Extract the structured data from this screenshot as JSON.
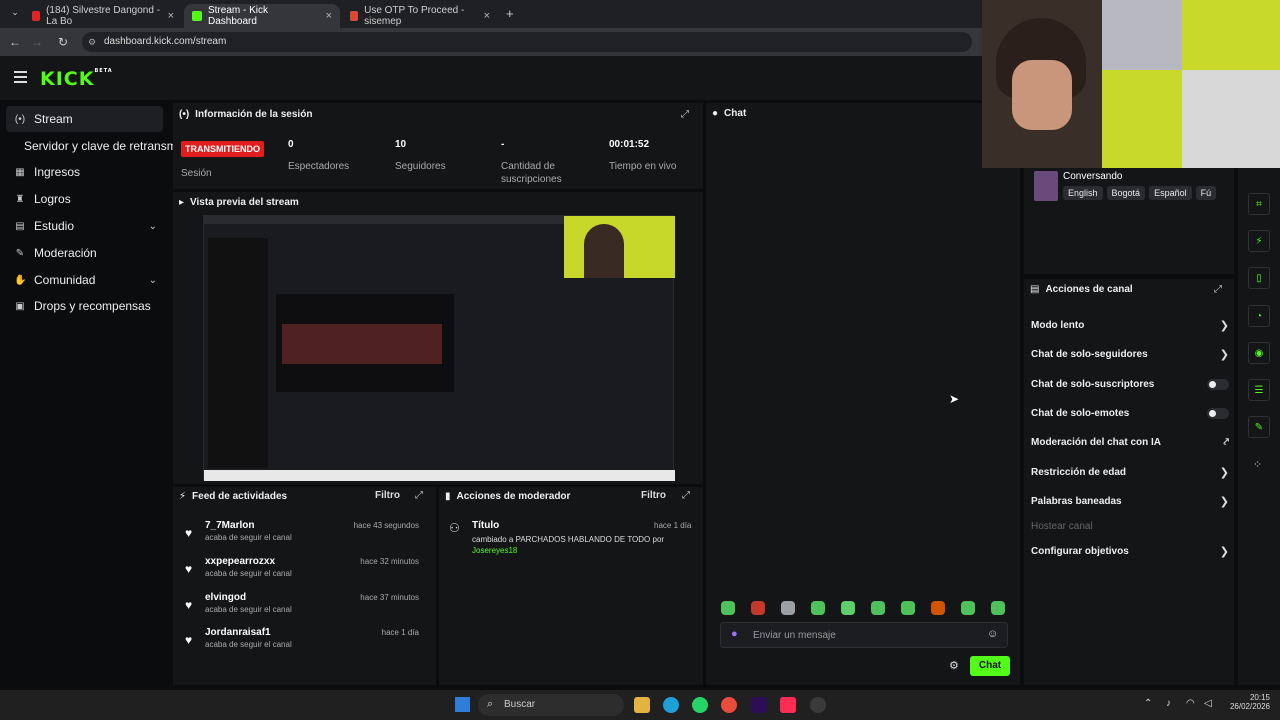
{
  "browser": {
    "tabs": [
      {
        "title": "(184) Silvestre Dangond - La Bo"
      },
      {
        "title": "Stream - Kick Dashboard"
      },
      {
        "title": "Use OTP To Proceed - sisemep"
      }
    ],
    "url": "dashboard.kick.com/stream"
  },
  "header": {
    "logo": "KICK",
    "logo_sup": "BETA"
  },
  "sidebar": {
    "items": [
      {
        "label": "Stream"
      },
      {
        "label": "Servidor y clave de retransmi"
      },
      {
        "label": "Ingresos"
      },
      {
        "label": "Logros"
      },
      {
        "label": "Estudio"
      },
      {
        "label": "Moderación"
      },
      {
        "label": "Comunidad"
      },
      {
        "label": "Drops y recompensas"
      }
    ]
  },
  "session": {
    "title": "Información de la sesión",
    "badge": "TRANSMITIENDO",
    "badge_sub": "Sesión",
    "stats": [
      {
        "value": "0",
        "label": "Espectadores"
      },
      {
        "value": "10",
        "label": "Seguidores"
      },
      {
        "value": "-",
        "label": "Cantidad de suscripciones"
      },
      {
        "value": "00:01:52",
        "label": "Tiempo en vivo"
      }
    ]
  },
  "preview": {
    "title": "Vista previa del stream"
  },
  "feed": {
    "title": "Feed de actividades",
    "filter": "Filtro",
    "items": [
      {
        "name": "7_7Marlon",
        "action": "acaba de seguir el canal",
        "time": "hace 43 segundos"
      },
      {
        "name": "xxpepearrozxx",
        "action": "acaba de seguir el canal",
        "time": "hace 32 minutos"
      },
      {
        "name": "elvingod",
        "action": "acaba de seguir el canal",
        "time": "hace 37 minutos"
      },
      {
        "name": "Jordanraisaf1",
        "action": "acaba de seguir el canal",
        "time": "hace 1 día"
      }
    ]
  },
  "mod": {
    "title": "Acciones de moderador",
    "filter": "Filtro",
    "item": {
      "label": "Título",
      "time": "hace 1 día",
      "text": "cambiado a PARCHADOS HABLANDO DE TODO por",
      "user": "Josereyes18"
    }
  },
  "chat": {
    "title": "Chat",
    "placeholder": "Enviar un mensaje",
    "send": "Chat"
  },
  "stream_info": {
    "category": "Conversando",
    "tags": [
      "English",
      "Bogotá",
      "Español",
      "Fú"
    ]
  },
  "channel_actions": {
    "title": "Acciones de canal",
    "items": [
      {
        "label": "Modo lento",
        "kind": "arrow"
      },
      {
        "label": "Chat de solo-seguidores",
        "kind": "arrow"
      },
      {
        "label": "Chat de solo-suscriptores",
        "kind": "toggle"
      },
      {
        "label": "Chat de solo-emotes",
        "kind": "toggle"
      },
      {
        "label": "Moderación del chat con IA",
        "kind": "external"
      },
      {
        "label": "Restricción de edad",
        "kind": "arrow"
      },
      {
        "label": "Palabras baneadas",
        "kind": "arrow"
      },
      {
        "label": "Hostear canal",
        "kind": "disabled"
      },
      {
        "label": "Configurar objetivos",
        "kind": "arrow"
      }
    ]
  },
  "taskbar": {
    "search": "Buscar",
    "time": "20:15",
    "date": "26/02/2026"
  },
  "colors": {
    "accent": "#53fc18",
    "live": "#e01e1e",
    "panel": "#141517",
    "background": "#0b0c0d"
  }
}
